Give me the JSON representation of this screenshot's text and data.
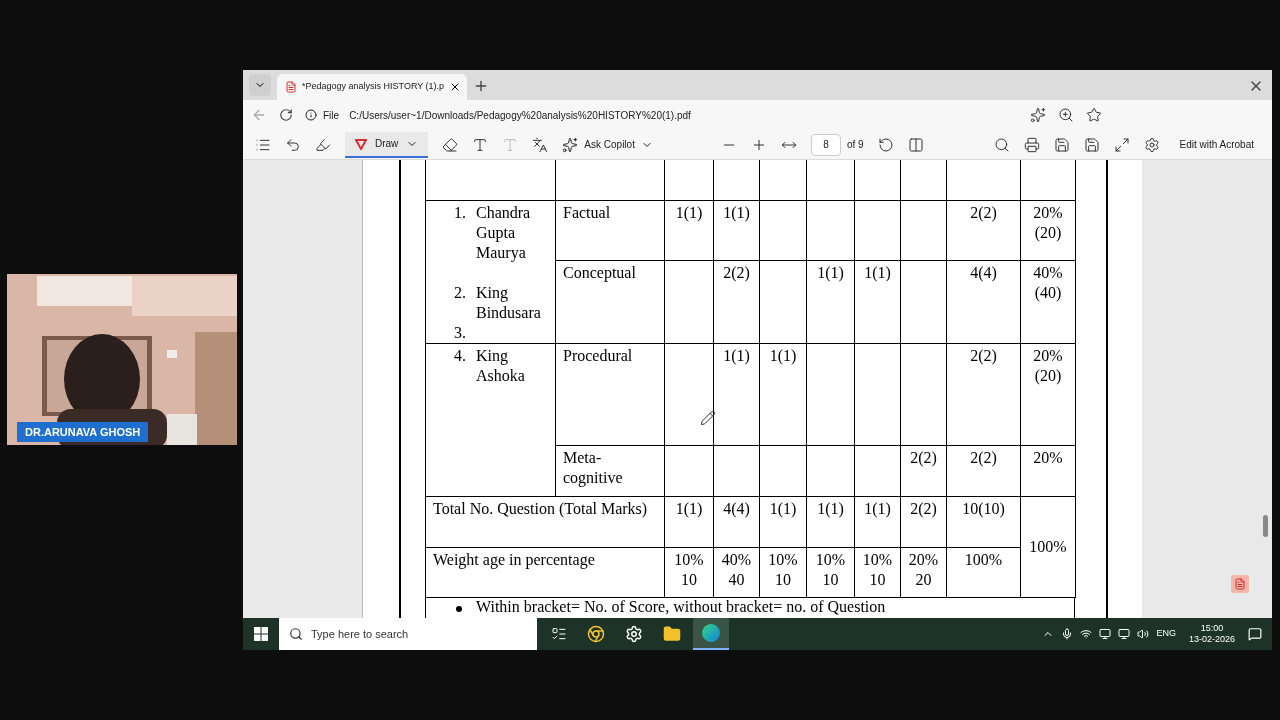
{
  "browser": {
    "tab": {
      "title": "*Pedagogy analysis HISTORY (1).p"
    },
    "address": {
      "scheme": "File",
      "url": "C:/Users/user~1/Downloads/Pedagogy%20analysis%20HISTORY%20(1).pdf"
    }
  },
  "pdf_toolbar": {
    "draw": {
      "label": "Draw",
      "selected": true
    },
    "copilot": "Ask Copilot",
    "page": "8",
    "page_count": "of 9",
    "acrobat": "Edit with Acrobat"
  },
  "table": {
    "topic_groups": [
      {
        "items": [
          {
            "number": "1.",
            "name": "Chandra Gupta Maurya"
          },
          {
            "number": "2.",
            "name": "King Bindusara"
          },
          {
            "number": "3."
          }
        ],
        "rows": [
          {
            "level": "Factual",
            "cells": [
              "1(1)",
              "1(1)",
              null,
              null,
              null,
              null,
              "2(2)"
            ],
            "weight": "20% (20)"
          },
          {
            "level": "Conceptual",
            "cells": [
              null,
              "2(2)",
              null,
              "1(1)",
              "1(1)",
              null,
              "4(4)"
            ],
            "weight": "40% (40)"
          }
        ]
      },
      {
        "items": [
          {
            "number": "4.",
            "name": "King Ashoka"
          }
        ],
        "rows": [
          {
            "level": "Procedural",
            "cells": [
              null,
              "1(1)",
              "1(1)",
              null,
              null,
              null,
              "2(2)"
            ],
            "weight": "20% (20)"
          },
          {
            "level": "Meta-cognitive",
            "cells": [
              null,
              null,
              null,
              null,
              null,
              "2(2)",
              "2(2)"
            ],
            "weight": "20%"
          }
        ]
      }
    ],
    "totals": {
      "label": "Total No. Question (Total Marks)",
      "cells": [
        "1(1)",
        "4(4)",
        "1(1)",
        "1(1)",
        "1(1)",
        "2(2)",
        "10(10)"
      ]
    },
    "weightage": {
      "label": "Weight age in percentage",
      "cells": [
        "10% 10",
        "40% 40",
        "10% 10",
        "10% 10",
        "10% 10",
        "20% 20",
        "100%"
      ]
    },
    "grand_total": "100%"
  },
  "footnote": "Within bracket= No. of Score, without bracket= no. of Question",
  "taskbar": {
    "search_placeholder": "Type here to search",
    "language": "ENG",
    "time": "15:00",
    "date": "13-02-2026"
  },
  "webcam": {
    "kind": "picture",
    "name": "DR.ARUNAVA GHOSH"
  }
}
